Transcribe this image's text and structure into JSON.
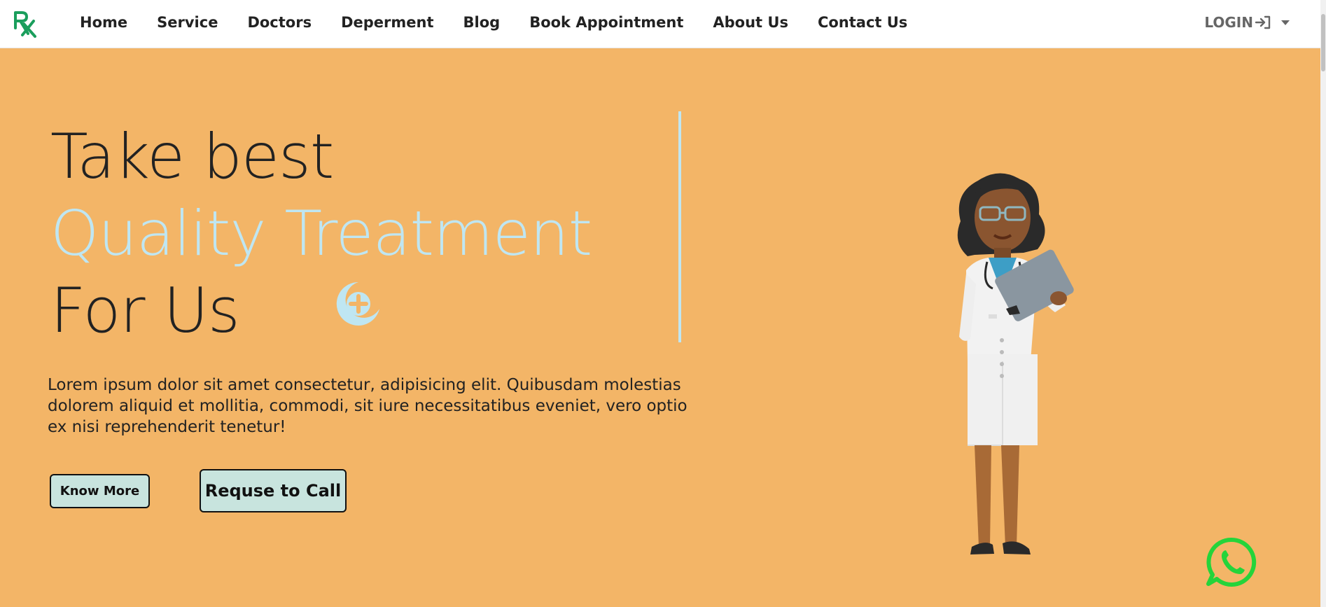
{
  "navbar": {
    "logo_icon": "rx-logo-icon",
    "links": [
      "Home",
      "Service",
      "Doctors",
      "Deperment",
      "Blog",
      "Book Appointment",
      "About Us",
      "Contact Us"
    ],
    "login_label": "LOGIN",
    "login_icon": "login-arrow-icon",
    "dropdown_icon": "caret-down-icon"
  },
  "hero": {
    "headline_line1": "Take best",
    "headline_line2": "Quality Treatment",
    "headline_line3": "For Us",
    "description": "Lorem ipsum dolor sit amet consectetur, adipisicing elit. Quibusdam molestias dolorem aliquid et mollitia, commodi, sit iure necessitatibus eveniet, vero optio ex nisi reprehenderit tenetur!",
    "know_more_label": "Know More",
    "request_call_label": "Requse to Call",
    "decor_icon": "medical-plus-icon",
    "illustration": "doctor-illustration"
  },
  "floating": {
    "whatsapp_icon": "whatsapp-icon"
  },
  "colors": {
    "hero_background": "#f3b567",
    "accent": "#bfe6f2",
    "button_background": "#c8e4de",
    "logo_green": "#1a9e5c",
    "whatsapp_green": "#25d43a"
  }
}
